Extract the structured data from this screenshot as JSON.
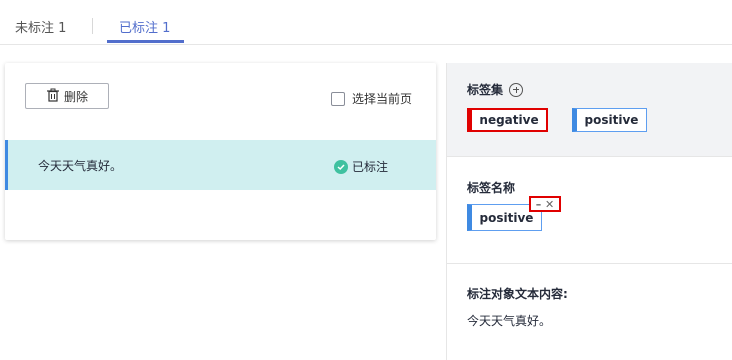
{
  "tabs": [
    {
      "label": "未标注 1"
    },
    {
      "label": "已标注 1",
      "active": true
    }
  ],
  "toolbar": {
    "delete_label": "删除",
    "select_current_label": "选择当前页"
  },
  "items": [
    {
      "text": "今天天气真好。",
      "status": "已标注",
      "selected": false
    }
  ],
  "label_set": {
    "title": "标签集",
    "labels": [
      "negative",
      "positive"
    ]
  },
  "label_name": {
    "title": "标签名称",
    "value": "positive"
  },
  "object_text": {
    "title": "标注对象文本内容:",
    "value": "今天天气真好。"
  },
  "colors": {
    "accent": "#526ecc",
    "tag_stripe": "#3f8ae2",
    "row_bg": "#d0eff0",
    "status_ok": "#3fc1a0",
    "highlight_red": "#e00000"
  },
  "icons": [
    "trash-icon",
    "checkbox-icon",
    "check-circle-icon",
    "add-circle-icon",
    "close-icon"
  ]
}
